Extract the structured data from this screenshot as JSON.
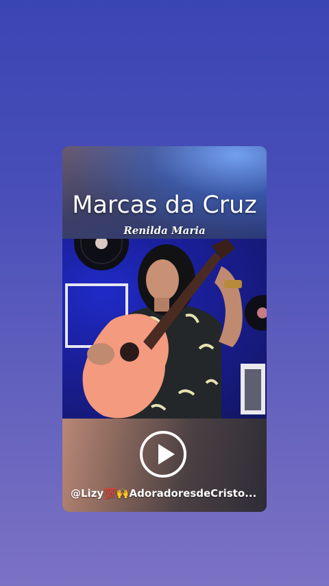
{
  "post": {
    "title": "Marcas da Cruz",
    "artist": "Renilda Maria",
    "caption": "@Lizy💯🙌AdoradoresdeCristo..."
  },
  "controls": {
    "play_icon": "play-icon"
  },
  "colors": {
    "background_top": "#3a45b4",
    "background_bottom": "#7c72c4",
    "video_backlight": "#1f2bc7",
    "guitar": "#f49a7e"
  }
}
